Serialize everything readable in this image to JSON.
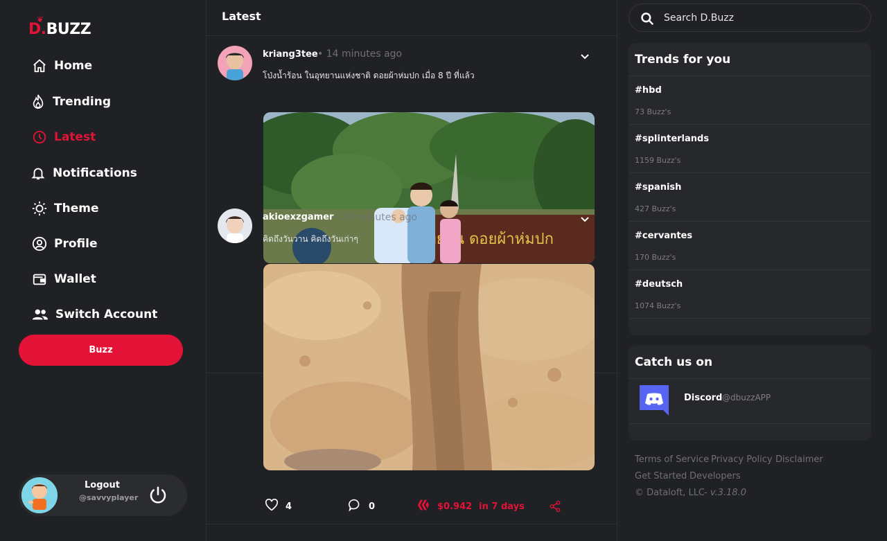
{
  "app": {
    "logo_d": "D.",
    "logo_buzz": "BUZZ"
  },
  "nav": {
    "home": "Home",
    "trending": "Trending",
    "latest": "Latest",
    "notifications": "Notifications",
    "theme": "Theme",
    "profile": "Profile",
    "wallet": "Wallet",
    "switch_account": "Switch Account"
  },
  "buzz_button": "Buzz",
  "account": {
    "logout": "Logout",
    "handle": "@savvyplayer"
  },
  "feed": {
    "title": "Latest",
    "posts": [
      {
        "author": "kriang3tee",
        "time": "• 14 minutes ago",
        "text": "โป่งน้ำร้อน ในอุทยานแห่งชาติ ดอยผ้าห่มปก เมื่อ 8 ปี ที่แล้ว",
        "sign_text": "อุทยาน   ดอยผ้าห่มปก"
      },
      {
        "author": "akioexzgamer",
        "time": "• 20 minutes ago",
        "text": "คิดถึงวันวาน คิดถึงวันเก่าๆ",
        "likes": "4",
        "comments": "0",
        "payout": "$0.942",
        "payout_time": "in 7 days"
      }
    ]
  },
  "search": {
    "placeholder": "Search D.Buzz"
  },
  "trends": {
    "title": "Trends for you",
    "items": [
      {
        "tag": "#hbd",
        "count": "73 Buzz's"
      },
      {
        "tag": "#splinterlands",
        "count": "1159 Buzz's"
      },
      {
        "tag": "#spanish",
        "count": "427 Buzz's"
      },
      {
        "tag": "#cervantes",
        "count": "170 Buzz's"
      },
      {
        "tag": "#deutsch",
        "count": "1074 Buzz's"
      }
    ]
  },
  "catch": {
    "title": "Catch us on",
    "discord_name": "Discord",
    "discord_handle": "@dbuzzAPP"
  },
  "footer": {
    "terms": "Terms of Service",
    "privacy": "Privacy Policy",
    "disclaimer": "Disclaimer",
    "get_started": "Get Started",
    "developers": "Developers",
    "copyright": "© Dataloft, LLC",
    "version": "- v.3.18.0"
  },
  "colors": {
    "accent": "#e31337",
    "background": "#202124",
    "panel": "#27282c",
    "discord": "#5865f2"
  }
}
